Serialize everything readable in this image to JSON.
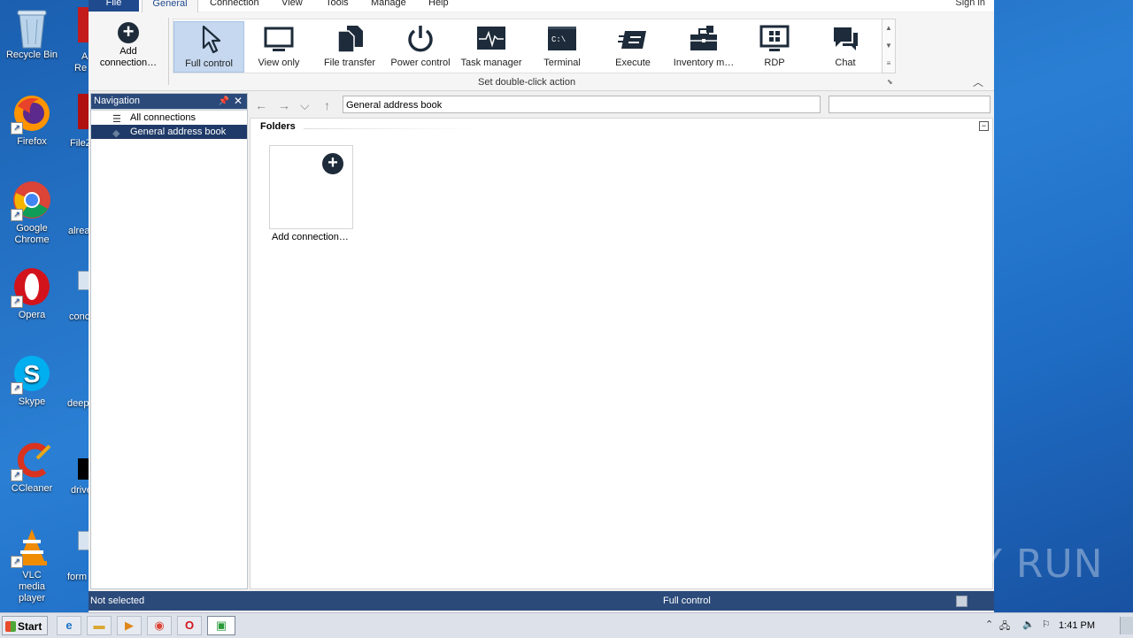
{
  "desktop": {
    "icons": [
      {
        "label": "Recycle Bin",
        "name": "recycle-bin-icon"
      },
      {
        "label": "Firefox",
        "name": "firefox-icon"
      },
      {
        "label": "Google Chrome",
        "name": "chrome-icon"
      },
      {
        "label": "Opera",
        "name": "opera-icon"
      },
      {
        "label": "Skype",
        "name": "skype-icon"
      },
      {
        "label": "CCleaner",
        "name": "ccleaner-icon"
      },
      {
        "label": "VLC media player",
        "name": "vlc-icon"
      }
    ],
    "partial_labels": [
      "A",
      "Re",
      "FileZ",
      "alrea",
      "conc",
      "deep",
      "drive",
      "form"
    ]
  },
  "menu": {
    "file": "File",
    "general": "General",
    "connection": "Connection",
    "view": "View",
    "tools": "Tools",
    "manage": "Manage",
    "help": "Help",
    "signin": "Sign in"
  },
  "ribbon": {
    "add_connection": "Add connection…",
    "actions": [
      {
        "label": "Full control",
        "icon": "cursor-icon",
        "selected": true
      },
      {
        "label": "View only",
        "icon": "monitor-icon"
      },
      {
        "label": "File transfer",
        "icon": "files-icon"
      },
      {
        "label": "Power control",
        "icon": "power-icon"
      },
      {
        "label": "Task manager",
        "icon": "pulse-icon"
      },
      {
        "label": "Terminal",
        "icon": "terminal-icon"
      },
      {
        "label": "Execute",
        "icon": "execute-icon"
      },
      {
        "label": "Inventory m…",
        "icon": "toolbox-icon"
      },
      {
        "label": "RDP",
        "icon": "rdp-icon"
      },
      {
        "label": "Chat",
        "icon": "chat-icon"
      }
    ],
    "group_label": "Set double-click action"
  },
  "navigation": {
    "title": "Navigation",
    "items": [
      {
        "label": "All connections",
        "selected": false
      },
      {
        "label": "General address book",
        "selected": true
      }
    ]
  },
  "address_bar": {
    "value": "General address book",
    "search_value": ""
  },
  "content": {
    "folders_header": "Folders",
    "tile_label": "Add connection…"
  },
  "status": {
    "left": "Not selected",
    "mid": "Full control"
  },
  "taskbar": {
    "start": "Start",
    "clock": "1:41 PM"
  },
  "watermark": "ANY RUN"
}
